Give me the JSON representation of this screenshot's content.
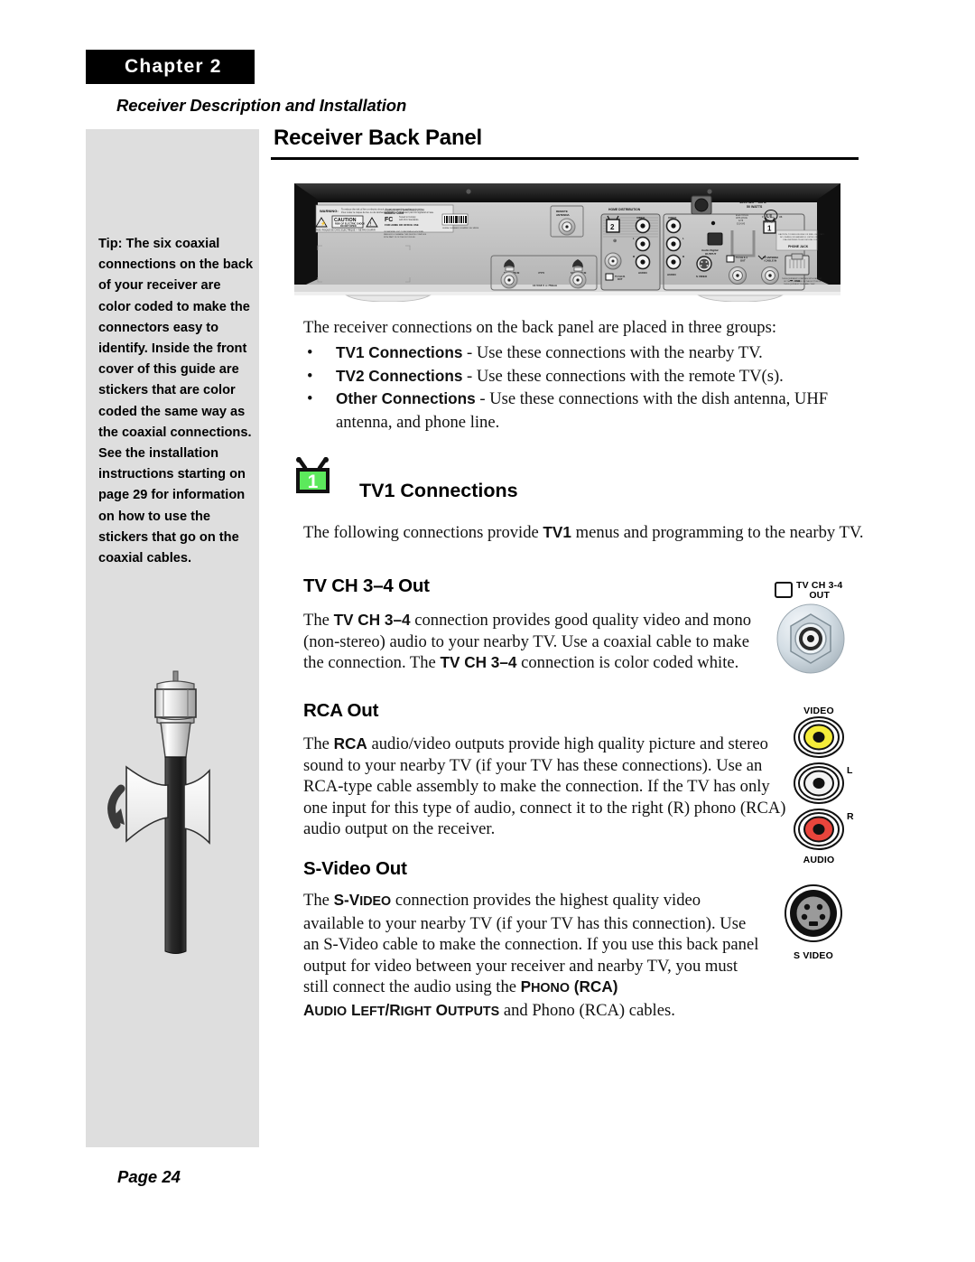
{
  "header": {
    "chapter_label": "Chapter 2",
    "chapter_subtitle": "Receiver Description and Installation",
    "main_heading": "Receiver Back Panel"
  },
  "sidebar": {
    "tip_text": "Tip: The six coaxial connections on the back of your receiver are color coded to make the connectors easy to identify. Inside the front cover of this guide are stickers that are color coded the same way as the coaxial connections. See the installation instructions starting on page 29 for information on how to use the stickers that go on the coaxial cables.",
    "illustration_name": "coaxial-cable-with-sticker"
  },
  "body": {
    "intro": "The receiver connections on the back panel are placed in three groups:",
    "bullets": [
      {
        "bullet": "•",
        "term": "TV1 Connections",
        "rest": " - Use these connections with the nearby TV."
      },
      {
        "bullet": "•",
        "term": "TV2 Connections",
        "rest": " - Use these connections with the remote TV(s)."
      },
      {
        "bullet": "•",
        "term": "Other Connections",
        "rest": " - Use these connections with the dish antenna, UHF antenna, and phone line."
      }
    ]
  },
  "tv1_section": {
    "icon_number": "1",
    "icon_color": "#5ce95c",
    "heading": "TV1 Connections",
    "intro_a": "The following connections provide ",
    "intro_b": "TV1",
    "intro_c": " menus and programming to the nearby TV."
  },
  "tvch_section": {
    "heading": "TV CH 3–4 Out",
    "p1": "The ",
    "p2": "TV CH 3–4",
    "p3": " connection provides good quality video and mono (non-stereo) audio to your nearby TV. Use a coaxial cable to make the connection. The ",
    "p4": "TV CH 3–4",
    "p5": " connection is color coded white."
  },
  "rca_section": {
    "heading": "RCA Out",
    "p1": "The ",
    "p2": "RCA",
    "p3": " audio/video outputs provide high quality picture and stereo sound to your nearby TV (if your TV has these connections). Use an RCA-type cable assembly to make the connection. If the TV has only one input for this type of audio, connect it to the right (R) phono (RCA) audio output on the receiver."
  },
  "svideo_section": {
    "heading": "S-Video Out",
    "p1": "The ",
    "p2_big": "S-V",
    "p2_small": "IDEO",
    "p3": " connection provides the highest quality video available to your nearby TV (if your TV has this connection). Use an S-Video cable to make the connection. If you use this back panel output for video between your receiver and nearby TV, you must still connect the audio using the ",
    "p4_big": "P",
    "p4_small": "HONO",
    "p4_rest": " (RCA)",
    "p5_big": "A",
    "p5_small1": "UDIO",
    "p5_big2": " L",
    "p5_small2": "EFT",
    "p5_big3": "/R",
    "p5_small3": "IGHT",
    "p5_big4": " O",
    "p5_small4": "UTPUTS",
    "p6": " and Phono (RCA) cables."
  },
  "connector_icons": {
    "tvch": {
      "box_label_line1": "TV CH 3-4",
      "box_label_line2": "OUT",
      "name": "coax-f-connector"
    },
    "rca": {
      "top_caption": "VIDEO",
      "bottom_caption": "AUDIO",
      "jacks": [
        {
          "label": "",
          "color": "#f5ec3a",
          "name": "rca-video-jack"
        },
        {
          "label": "L",
          "color": "#f2f2f2",
          "name": "rca-audio-left-jack"
        },
        {
          "label": "R",
          "color": "#e8453c",
          "name": "rca-audio-right-jack"
        }
      ]
    },
    "svideo": {
      "caption": "S VIDEO",
      "name": "s-video-mini-din-jack"
    }
  },
  "receiver_panel": {
    "alt": "Rear panel photograph of satellite receiver",
    "labels": {
      "warning": "WARNING",
      "caution": "CAUTION",
      "caution_sub": "RISK OF ELECTRIC SHOCK DO NOT OPEN",
      "fcc": "FC",
      "model": "MODEL: DISH",
      "office_use": "FOR HOME OR OFFICE USE",
      "remote_antenna": "REMOTE ANTENNA",
      "satellite_in_1": "SATELLITE IN",
      "satellite_in_2": "SATELLITE IN",
      "power_rating_small": "13 V/18 V 750mA",
      "home_distribution": "HOME DISTRIBUTION",
      "tv2_number": "2",
      "video": "VIDEO",
      "left": "L",
      "right": "R",
      "audio": "AUDIO",
      "tv_ch_21_out": "TV CH 21 OUT",
      "audio_digital_output": "Audio Digital OUTPUT",
      "tv1_number": "1",
      "s_video": "S VIDEO",
      "tv_ch_34_out": "TV CH 3-4 OUT",
      "tv_antenna_cable_in": "TV ANTENNA / CABLE IN",
      "usb": "USB",
      "phone_jack": "PHONE JACK",
      "mains": "120V AC ~ 60Hz",
      "watts": "50 WATTS",
      "ul": "UL",
      "listed": "LISTED"
    }
  },
  "footer": {
    "page_number": "Page 24"
  }
}
